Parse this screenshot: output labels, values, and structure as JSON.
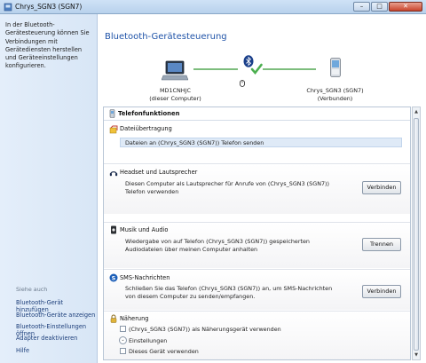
{
  "window": {
    "title": "Chrys_SGN3 (SGN7)",
    "controls": [
      "–",
      "□",
      "✕"
    ]
  },
  "sidebar": {
    "description": "In der Bluetooth-Gerätesteuerung können Sie Verbindungen mit Gerätediensten herstellen und Geräteeinstellungen konfigurieren.",
    "see_also": "Siehe auch",
    "links": [
      "Bluetooth-Gerät hinzufügen",
      "Bluetooth-Geräte anzeigen",
      "Bluetooth-Einstellungen öffnen",
      "Adapter deaktivieren",
      "Hilfe"
    ]
  },
  "main": {
    "title": "Bluetooth-Gerätesteuerung",
    "computer": {
      "name": "MD1CNHJC",
      "role": "(dieser Computer)"
    },
    "phone": {
      "name": "Chrys_SGN3 (SGN7)",
      "status": "(Verbunden)"
    },
    "section_title": "Telefonfunktionen",
    "file_transfer": {
      "title": "Dateiübertragung",
      "action": "Dateien an (Chrys_SGN3 (SGN7)) Telefon senden"
    },
    "headset": {
      "title": "Headset und Lautsprecher",
      "text": "Diesen Computer als Lautsprecher für Anrufe von (Chrys_SGN3 (SGN7)) Telefon verwenden",
      "button": "Verbinden"
    },
    "music": {
      "title": "Musik und Audio",
      "text": "Wiedergabe von auf Telefon (Chrys_SGN3 (SGN7)) gespeicherten Audiodateien über meinen Computer anhalten",
      "button": "Trennen"
    },
    "sms": {
      "title": "SMS-Nachrichten",
      "text": "Schließen Sie das Telefon (Chrys_SGN3 (SGN7)) an, um SMS-Nachrichten von diesem Computer zu senden/empfangen.",
      "button": "Verbinden"
    },
    "proximity": {
      "title": "Näherung",
      "option1": "(Chrys_SGN3 (SGN7)) als Näherungsgerät verwenden",
      "settings": "Einstellungen",
      "option2": "Dieses Gerät verwenden"
    }
  },
  "colors": {
    "accent": "#1f53a8",
    "connection": "#7dbd7d",
    "bluetooth": "#1a3f8a"
  }
}
